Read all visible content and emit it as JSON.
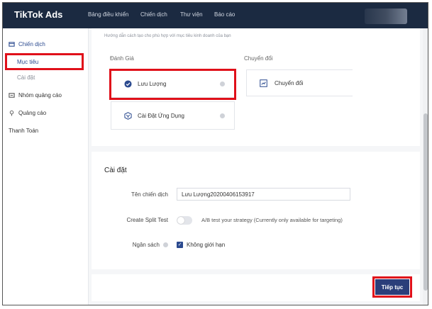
{
  "app": {
    "logo": "TikTok Ads"
  },
  "topnav": {
    "items": [
      "Bảng điều khiển",
      "Chiến dịch",
      "Thư viện",
      "Báo cáo"
    ]
  },
  "sidebar": {
    "campaign": "Chiến dịch",
    "objective": "Mục tiêu",
    "settings": "Cài đặt",
    "adgroup": "Nhóm quảng cáo",
    "ad": "Quảng cáo",
    "payment": "Thanh Toán"
  },
  "objective": {
    "hint": "Hướng dẫn cách tạo cho phù hợp với mục tiêu kinh doanh của bạn",
    "group_consideration": "Đánh Giá",
    "group_conversion": "Chuyển đổi",
    "traffic": "Lưu Lượng",
    "app_install": "Cài Đặt Ứng Dụng",
    "conversions": "Chuyển đổi"
  },
  "settings": {
    "title": "Cài đặt",
    "campaign_name_label": "Tên chiến dịch",
    "campaign_name_value": "Lưu Lượng20200406153917",
    "split_test_label": "Create Split Test",
    "split_test_desc": "A/B test your strategy (Currently only available for targeting)",
    "budget_label": "Ngân sách",
    "budget_option": "Không giới hạn"
  },
  "footer": {
    "continue": "Tiếp tục"
  },
  "colors": {
    "topbar": "#1b2a41",
    "accent": "#2b4a8f",
    "highlight": "#e0101a",
    "button": "#2b3e7a"
  }
}
